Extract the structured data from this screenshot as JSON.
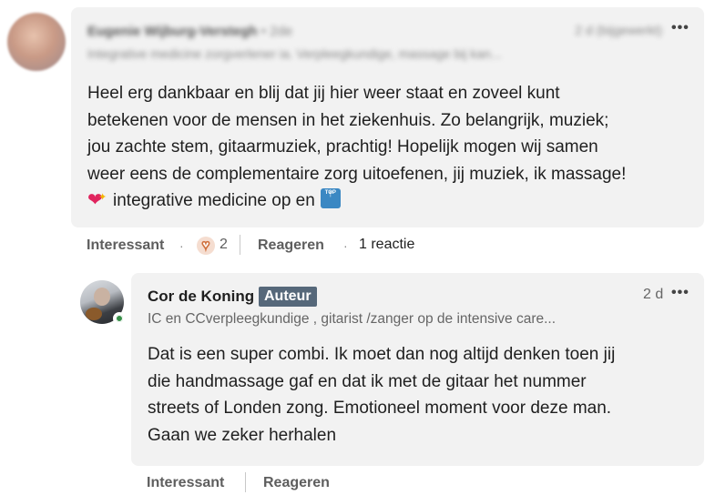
{
  "comment_1": {
    "author_name": "Eugenie Wijburg-Verstegh",
    "degree": "• 2de",
    "headline": "Integrative medicine zorgverlener ia. Verpleegkundige, massage bij kan...",
    "time": "2 d (bijgewerkt)",
    "more_icon": "more-horizontal-icon",
    "body_lines": [
      "Heel erg dankbaar en blij dat jij hier weer staat en zoveel kunt",
      "betekenen voor de mensen in het ziekenhuis. Zo belangrijk, muziek;",
      "jou zachte stem, gitaarmuziek, prachtig! Hopelijk mogen wij samen",
      "weer eens de complementaire zorg uitoefenen, jij muziek, ik massage!"
    ],
    "body_last_text": "integrative medicine op en",
    "emoji_1": "sparkling-heart-icon",
    "emoji_2": "top-arrow-icon",
    "actions": {
      "like": "Interessant",
      "reaction_icon": "heart-reaction-icon",
      "reaction_count": "2",
      "reply": "Reageren",
      "reply_count": "1 reactie"
    }
  },
  "comment_2": {
    "author_name": "Cor de Koning",
    "badge": "Auteur",
    "time": "2 d",
    "headline": "IC en CCverpleegkundige , gitarist /zanger op de intensive care...",
    "more_icon": "more-horizontal-icon",
    "status": "online",
    "status_color": "#378f48",
    "body_lines": [
      "Dat is een super combi. Ik moet dan nog altijd denken toen jij",
      "die handmassage gaf en dat ik met de gitaar het nummer",
      "streets of Londen zong. Emotioneel moment voor deze man.",
      "Gaan we zeker herhalen"
    ],
    "actions": {
      "like": "Interessant",
      "reply": "Reageren"
    }
  },
  "colors": {
    "bubble_bg": "#f2f2f2",
    "badge_bg": "#56687a",
    "reaction_accent": "#d0703d"
  }
}
